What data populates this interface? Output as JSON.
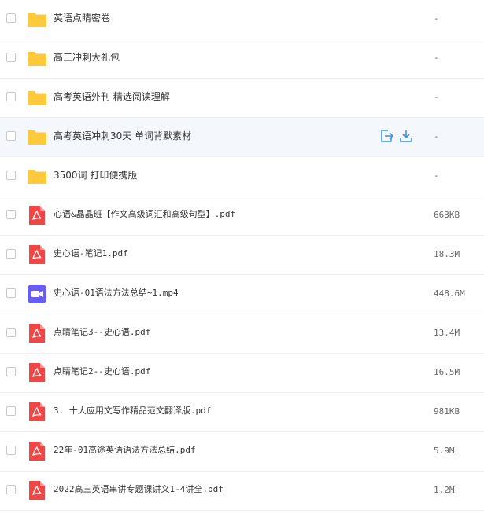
{
  "colors": {
    "folder": "#ffc93c",
    "pdf": "#f04646",
    "video": "#6a5ef0",
    "action": "#3b8fe0"
  },
  "files": [
    {
      "name": "英语点睛密卷",
      "type": "folder",
      "size": "-"
    },
    {
      "name": "高三冲刺大礼包",
      "type": "folder",
      "size": "-"
    },
    {
      "name": "高考英语外刊 精选阅读理解",
      "type": "folder",
      "size": "-"
    },
    {
      "name": "高考英语冲刺30天 单词背默素材",
      "type": "folder",
      "size": "-",
      "hovered": true
    },
    {
      "name": "3500词 打印便携版",
      "type": "folder",
      "size": "-"
    },
    {
      "name": "心语&晶晶班【作文高级词汇和高级句型】.pdf",
      "type": "pdf",
      "size": "663KB"
    },
    {
      "name": "史心语-笔记1.pdf",
      "type": "pdf",
      "size": "18.3M"
    },
    {
      "name": "史心语-01语法方法总结~1.mp4",
      "type": "video",
      "size": "448.6M"
    },
    {
      "name": "点睛笔记3--史心语.pdf",
      "type": "pdf",
      "size": "13.4M"
    },
    {
      "name": "点睛笔记2--史心语.pdf",
      "type": "pdf",
      "size": "16.5M"
    },
    {
      "name": "3. 十大应用文写作精品范文翻译版.pdf",
      "type": "pdf",
      "size": "981KB"
    },
    {
      "name": "22年-01高途英语语法方法总结.pdf",
      "type": "pdf",
      "size": "5.9M"
    },
    {
      "name": "2022高三英语串讲专题课讲义1-4讲全.pdf",
      "type": "pdf",
      "size": "1.2M"
    }
  ],
  "row_actions": {
    "share_icon": "share-icon",
    "download_icon": "download-icon"
  }
}
